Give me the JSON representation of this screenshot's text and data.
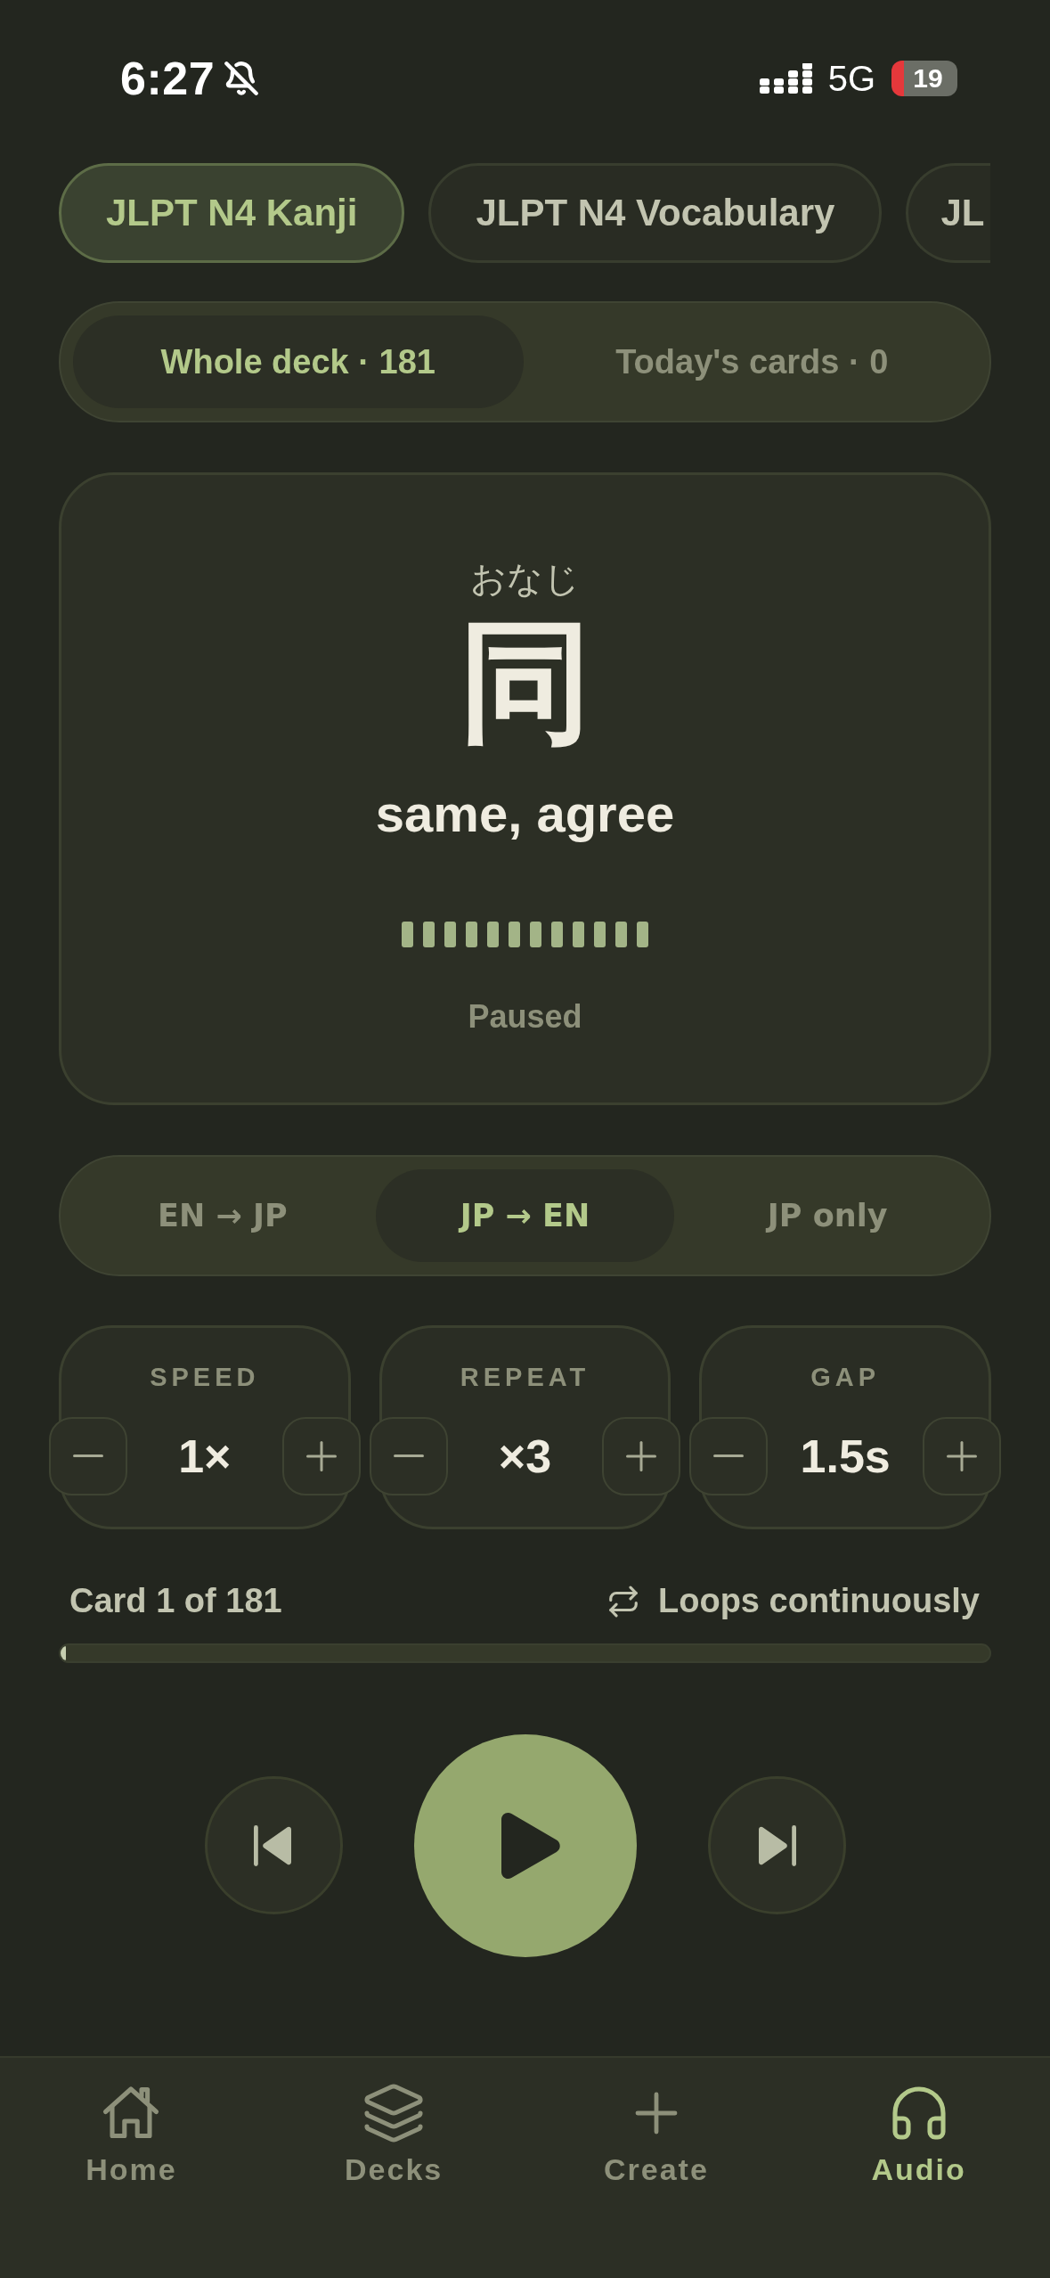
{
  "status_bar": {
    "time": "6:27",
    "network": "5G",
    "battery": "19"
  },
  "deck_chips": [
    {
      "label": "JLPT N4 Kanji",
      "selected": true
    },
    {
      "label": "JLPT N4 Vocabulary",
      "selected": false
    },
    {
      "label": "JL",
      "selected": false
    }
  ],
  "scope_toggle": [
    {
      "label": "Whole deck · 181",
      "selected": true
    },
    {
      "label": "Today's cards · 0",
      "selected": false
    }
  ],
  "card": {
    "reading": "おなじ",
    "kanji": "同",
    "meaning": "same, agree",
    "status": "Paused"
  },
  "direction_toggle": [
    {
      "label": "EN → JP",
      "selected": false
    },
    {
      "label": "JP → EN",
      "selected": true
    },
    {
      "label": "JP only",
      "selected": false
    }
  ],
  "settings": [
    {
      "label": "SPEED",
      "value": "1×"
    },
    {
      "label": "REPEAT",
      "value": "×3"
    },
    {
      "label": "GAP",
      "value": "1.5s"
    }
  ],
  "progress": {
    "position": "Card 1 of 181",
    "loop_label": "Loops continuously",
    "level": 0.0055
  },
  "playback": {
    "playing": false
  },
  "tab_bar": [
    {
      "label": "Home",
      "selected": false
    },
    {
      "label": "Decks",
      "selected": false
    },
    {
      "label": "Create",
      "selected": false
    },
    {
      "label": "Audio",
      "selected": true
    }
  ]
}
